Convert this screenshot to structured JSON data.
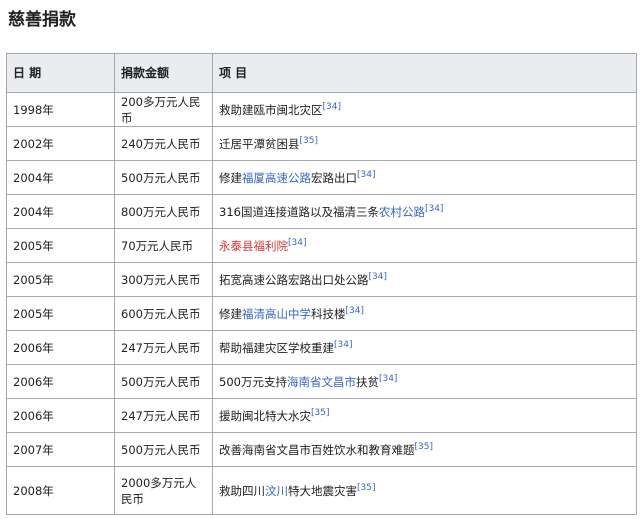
{
  "section_title": "慈善捐款",
  "headers": [
    "日 期",
    "捐款金额",
    "项 目"
  ],
  "rows": [
    {
      "date": "1998年",
      "amount": "200多万元人民币",
      "parts": [
        {
          "t": "救助建瓯市闽北灾区"
        }
      ],
      "ref": "[34]"
    },
    {
      "date": "2002年",
      "amount": "240万元人民币",
      "parts": [
        {
          "t": "迁居平潭贫困县"
        }
      ],
      "ref": "[35]"
    },
    {
      "date": "2004年",
      "amount": "500万元人民币",
      "parts": [
        {
          "t": "修建"
        },
        {
          "t": "福厦高速公路",
          "link": true
        },
        {
          "t": "宏路出口"
        }
      ],
      "ref": "[34]"
    },
    {
      "date": "2004年",
      "amount": "800万元人民币",
      "parts": [
        {
          "t": "316国道连接道路以及福清三条"
        },
        {
          "t": "农村公路",
          "link": true
        }
      ],
      "ref": "[34]"
    },
    {
      "date": "2005年",
      "amount": "70万元人民币",
      "parts": [
        {
          "t": "永泰县福利院",
          "link": true,
          "new": true
        }
      ],
      "ref": "[34]"
    },
    {
      "date": "2005年",
      "amount": "300万元人民币",
      "parts": [
        {
          "t": "拓宽高速公路宏路出口处公路"
        }
      ],
      "ref": "[34]"
    },
    {
      "date": "2005年",
      "amount": "600万元人民币",
      "parts": [
        {
          "t": "修建"
        },
        {
          "t": "福清高山中学",
          "link": true
        },
        {
          "t": "科技楼"
        }
      ],
      "ref": "[34]"
    },
    {
      "date": "2006年",
      "amount": "247万元人民币",
      "parts": [
        {
          "t": "帮助福建灾区学校重建"
        }
      ],
      "ref": "[34]"
    },
    {
      "date": "2006年",
      "amount": "500万元人民币",
      "parts": [
        {
          "t": "500万元支持"
        },
        {
          "t": "海南省文昌市",
          "link": true
        },
        {
          "t": "扶贫"
        }
      ],
      "ref": "[34]"
    },
    {
      "date": "2006年",
      "amount": "247万元人民币",
      "parts": [
        {
          "t": "援助闽北特大水灾"
        }
      ],
      "ref": "[35]"
    },
    {
      "date": "2007年",
      "amount": "500万元人民币",
      "parts": [
        {
          "t": "改善海南省文昌市百姓饮水和教育难题"
        }
      ],
      "ref": "[35]"
    },
    {
      "date": "2008年",
      "amount": "2000多万元人民币",
      "parts": [
        {
          "t": "救助四川"
        },
        {
          "t": "汶川",
          "link": true
        },
        {
          "t": "特大地震灾害"
        }
      ],
      "ref": "[35]",
      "tall": true
    }
  ]
}
